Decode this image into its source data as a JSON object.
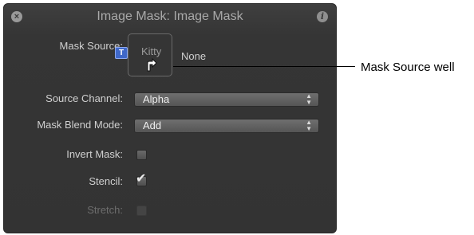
{
  "window": {
    "title": "Image Mask: Image Mask",
    "close_icon": "close-icon",
    "info_icon": "info-icon"
  },
  "fields": {
    "mask_source_label": "Mask Source:",
    "mask_source_badge": "T",
    "mask_source_layer": "Kitty",
    "mask_source_value": "None",
    "source_channel_label": "Source Channel:",
    "source_channel_value": "Alpha",
    "mask_blend_mode_label": "Mask Blend Mode:",
    "mask_blend_mode_value": "Add",
    "invert_mask_label": "Invert Mask:",
    "invert_mask_checked": false,
    "stencil_label": "Stencil:",
    "stencil_checked": true,
    "stretch_label": "Stretch:",
    "stretch_checked": false,
    "stretch_enabled": false
  },
  "callout": {
    "text": "Mask Source well"
  },
  "colors": {
    "panel_bg": "#353535",
    "badge": "#3f68c9"
  }
}
